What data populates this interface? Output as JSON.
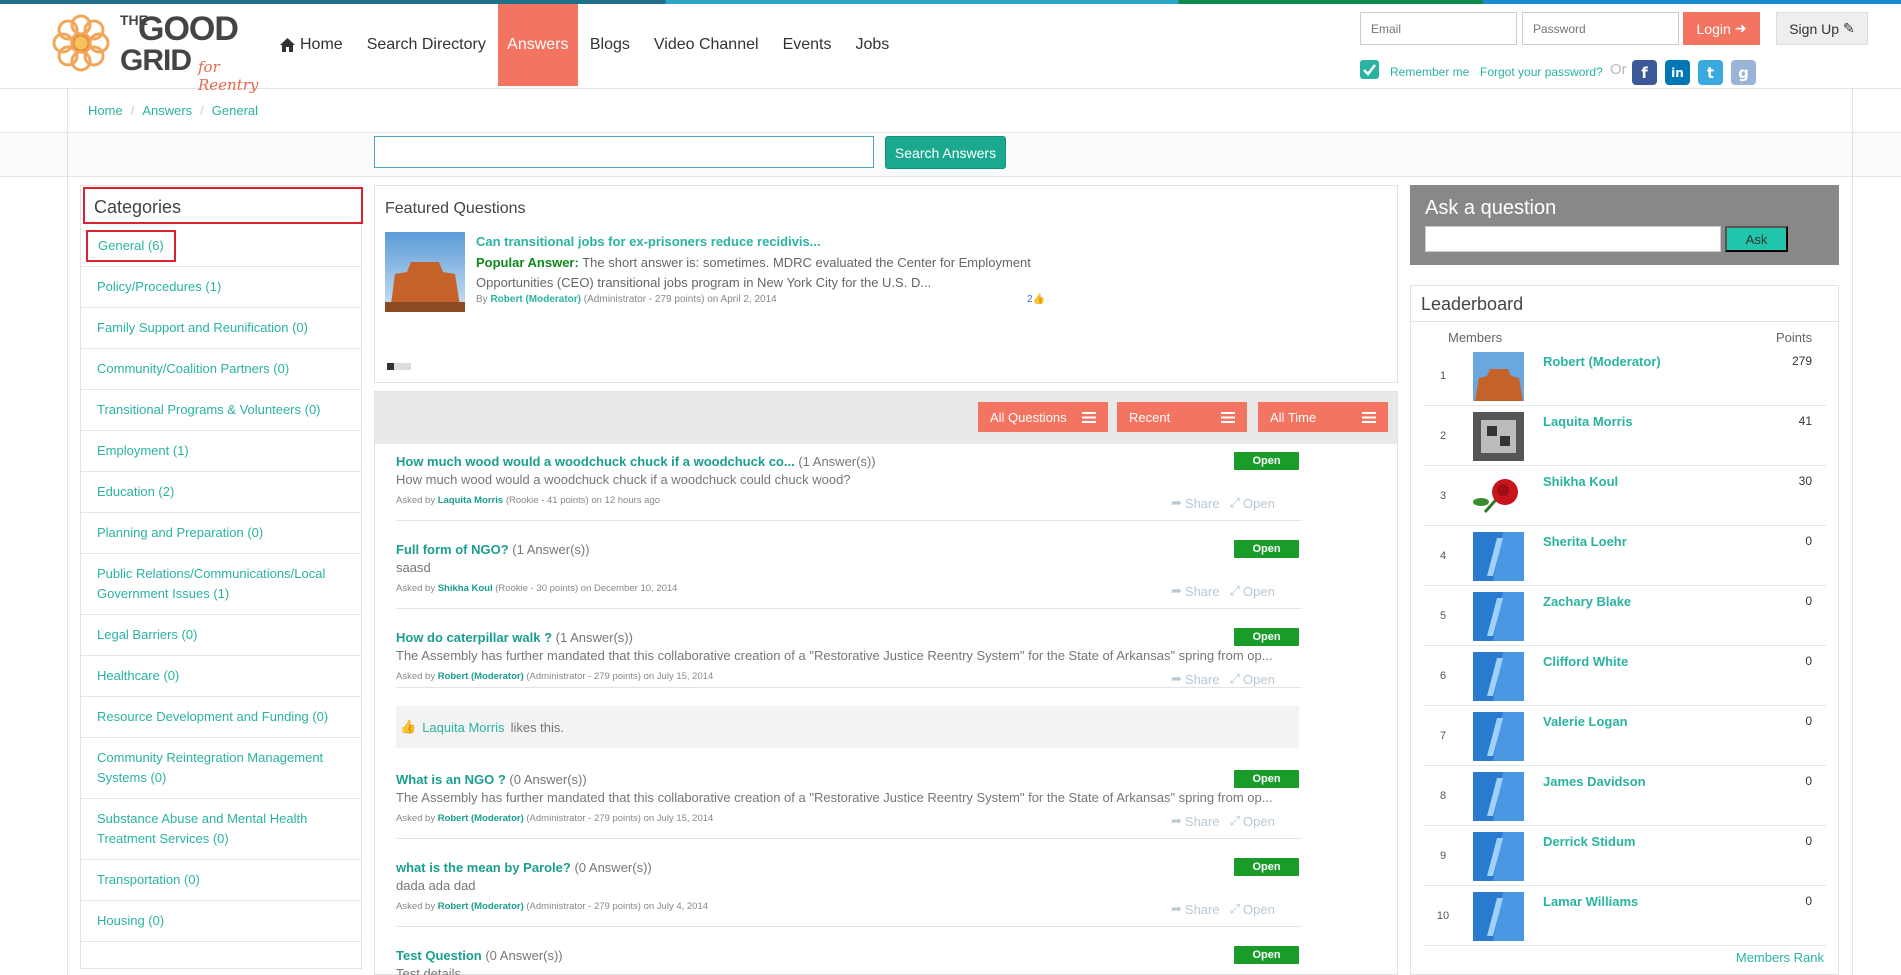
{
  "brand": {
    "the": "THE",
    "good": "GOOD",
    "grid": "GRID",
    "tagline": "for Reentry"
  },
  "nav": {
    "items": [
      {
        "label": "Home",
        "icon": "home-icon"
      },
      {
        "label": "Search Directory"
      },
      {
        "label": "Answers",
        "active": true
      },
      {
        "label": "Blogs"
      },
      {
        "label": "Video Channel"
      },
      {
        "label": "Events"
      },
      {
        "label": "Jobs"
      }
    ]
  },
  "login": {
    "email_placeholder": "Email",
    "password_placeholder": "Password",
    "login_label": "Login",
    "signup_label": "Sign Up",
    "remember_label": "Remember me",
    "forgot_label": "Forgot your password?",
    "or_label": "Or",
    "social": [
      "facebook",
      "linkedin",
      "twitter",
      "google"
    ]
  },
  "breadcrumb": [
    "Home",
    "Answers",
    "General"
  ],
  "search": {
    "button_label": "Search Answers",
    "value": ""
  },
  "categories": {
    "title": "Categories",
    "items": [
      "General (6)",
      "Policy/Procedures (1)",
      "Family Support and Reunification (0)",
      "Community/Coalition Partners (0)",
      "Transitional Programs & Volunteers (0)",
      "Employment (1)",
      "Education (2)",
      "Planning and Preparation (0)",
      "Public Relations/Communications/Local Government Issues (1)",
      "Legal Barriers (0)",
      "Healthcare (0)",
      "Resource Development and Funding (0)",
      "Community Reintegration Management Systems (0)",
      "Substance Abuse and Mental Health Treatment Services (0)",
      "Transportation (0)",
      "Housing (0)"
    ]
  },
  "featured": {
    "title": "Featured Questions",
    "question": "Can transitional jobs for ex-prisoners reduce recidivis...",
    "popular_label": "Popular Answer:",
    "answer": "The short answer is: sometimes. MDRC evaluated the Center for Employment Opportunities (CEO) transitional jobs program in New York City for the U.S. D...",
    "by_label": "By",
    "author": "Robert (Moderator)",
    "author_meta": "(Administrator - 279 points)",
    "date": "on April 2, 2014",
    "likes": "2"
  },
  "filters": {
    "questions": "All Questions",
    "recent": "Recent",
    "time": "All Time"
  },
  "questions": [
    {
      "title": "How much wood would a woodchuck chuck if a woodchuck co...",
      "count": "(1 Answer(s))",
      "body": "How much wood would a woodchuck chuck if a woodchuck could chuck wood?",
      "asked_by": "Asked by",
      "author": "Laquita Morris",
      "meta": "(Rookie - 41 points) on 12 hours ago",
      "status": "Open"
    },
    {
      "title": "Full form of NGO?",
      "count": "(1 Answer(s))",
      "body": "saasd",
      "asked_by": "Asked by",
      "author": "Shikha Koul",
      "meta": "(Rookie - 30 points) on December 10, 2014",
      "status": "Open"
    },
    {
      "title": "How do caterpillar walk ?",
      "count": "(1 Answer(s))",
      "body": "The Assembly has further mandated that this collaborative creation of a \"Restorative Justice Reentry System\" for the State of Arkansas\" spring from op...",
      "asked_by": "Asked by",
      "author": "Robert (Moderator)",
      "meta": "(Administrator - 279 points) on July 15, 2014",
      "status": "Open",
      "liked_by": "Laquita Morris",
      "likes_text": "likes this."
    },
    {
      "title": "What is an NGO ?",
      "count": "(0 Answer(s))",
      "body": "The Assembly has further mandated that this collaborative creation of a \"Restorative Justice Reentry System\" for the State of Arkansas\" spring from op...",
      "asked_by": "Asked by",
      "author": "Robert (Moderator)",
      "meta": "(Administrator - 279 points) on July 15, 2014",
      "status": "Open"
    },
    {
      "title": "what is the mean by Parole?",
      "count": "(0 Answer(s))",
      "body": "dada ada dad",
      "asked_by": "Asked by",
      "author": "Robert (Moderator)",
      "meta": "(Administrator - 279 points) on July 4, 2014",
      "status": "Open"
    },
    {
      "title": "Test Question",
      "count": "(0 Answer(s))",
      "body": "Test details",
      "asked_by": "",
      "author": "",
      "meta": "",
      "status": "Open"
    }
  ],
  "actions": {
    "share": "Share",
    "open": "Open"
  },
  "ask": {
    "title": "Ask a question",
    "button_label": "Ask"
  },
  "leaderboard": {
    "title": "Leaderboard",
    "members_label": "Members",
    "points_label": "Points",
    "members_rank_label": "Members Rank",
    "rows": [
      {
        "rank": "1",
        "name": "Robert (Moderator)",
        "points": "279",
        "avatar": "canyon"
      },
      {
        "rank": "2",
        "name": "Laquita Morris",
        "points": "41",
        "avatar": "love-sculpture"
      },
      {
        "rank": "3",
        "name": "Shikha Koul",
        "points": "30",
        "avatar": "rose"
      },
      {
        "rank": "4",
        "name": "Sherita Loehr",
        "points": "0",
        "avatar": "default"
      },
      {
        "rank": "5",
        "name": "Zachary Blake",
        "points": "0",
        "avatar": "default"
      },
      {
        "rank": "6",
        "name": "Clifford White",
        "points": "0",
        "avatar": "default"
      },
      {
        "rank": "7",
        "name": "Valerie Logan",
        "points": "0",
        "avatar": "default"
      },
      {
        "rank": "8",
        "name": "James Davidson",
        "points": "0",
        "avatar": "default"
      },
      {
        "rank": "9",
        "name": "Derrick Stidum",
        "points": "0",
        "avatar": "default"
      },
      {
        "rank": "10",
        "name": "Lamar Williams",
        "points": "0",
        "avatar": "default"
      }
    ]
  },
  "colors": {
    "accent": "#f47462",
    "teal": "#2ab3a0",
    "open_badge": "#1a9c2a",
    "highlight_border": "#d9232e"
  }
}
